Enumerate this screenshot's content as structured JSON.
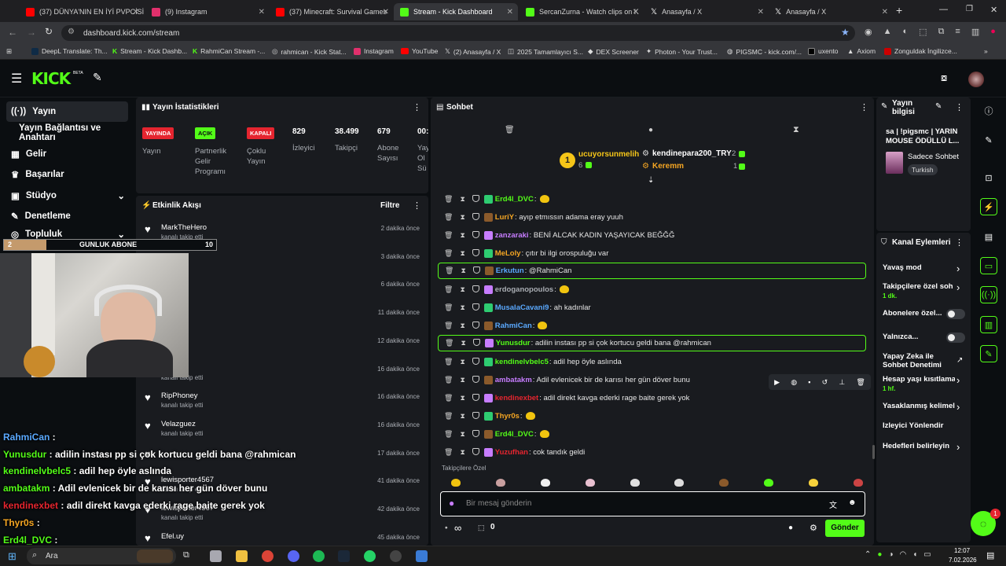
{
  "browser": {
    "tabs": [
      {
        "label": "(37) DÜNYA'NIN EN İYİ PVPCİSİ",
        "color": "#ff0000"
      },
      {
        "label": "(9) Instagram",
        "color": "#e1306c"
      },
      {
        "label": "(37) Minecraft: Survival Games",
        "color": "#ff0000"
      },
      {
        "label": "Stream - Kick Dashboard",
        "color": "#53fc18"
      },
      {
        "label": "SercanZurna - Watch clips on K",
        "color": "#53fc18"
      },
      {
        "label": "Anasayfa / X",
        "color": "#ffffff"
      },
      {
        "label": "Anasayfa / X",
        "color": "#ffffff"
      }
    ],
    "new_tab": "+",
    "url": "dashboard.kick.com/stream",
    "bookmarks": [
      "DeepL Translate: Th...",
      "Stream - Kick Dashb...",
      "RahmiCan Stream -...",
      "rahmican - Kick Stat...",
      "Instagram",
      "YouTube",
      "(2) Anasayfa / X",
      "2025 Tamamlayıcı S...",
      "DEX Screener",
      "Photon - Your Trust...",
      "PIGSMC - kick.com/...",
      "uxento",
      "Axiom",
      "Zonguldak İngilizce..."
    ]
  },
  "kick": {
    "logo": "KICK",
    "beta": "BETA"
  },
  "sidebar": {
    "items": [
      {
        "label": "Yayın",
        "icon": "broadcast-icon"
      },
      {
        "label": "Yayın Bağlantısı ve Anahtarı",
        "icon": ""
      },
      {
        "label": "Gelir",
        "icon": "money-icon"
      },
      {
        "label": "Başarılar",
        "icon": "trophy-icon"
      },
      {
        "label": "Stüdyo",
        "icon": "studio-icon"
      },
      {
        "label": "Denetleme",
        "icon": "wrench-icon"
      },
      {
        "label": "Topluluk",
        "icon": "community-icon"
      }
    ]
  },
  "stats": {
    "title": "Yayın İstatistikleri",
    "badges": [
      {
        "label": "YAYINDA",
        "sub": "Yayın",
        "color": "#e5252f"
      },
      {
        "label": "AÇIK",
        "sub": "Partnerlik Gelir Programı",
        "color": "#53fc18"
      },
      {
        "label": "KAPALI",
        "sub": "Çoklu Yayın",
        "color": "#e5252f"
      }
    ],
    "numbers": [
      {
        "value": "829",
        "label": "İzleyici"
      },
      {
        "value": "38.499",
        "label": "Takipçi"
      },
      {
        "value": "679",
        "label": "Abone Sayısı"
      },
      {
        "value": "00:",
        "label": "Yayın Ol Sü"
      }
    ]
  },
  "activity": {
    "title": "Etkinlik Akışı",
    "filter": "Filtre",
    "events": [
      {
        "name": "MarkTheHero",
        "sub": "kanalı takip etti",
        "time": "2 dakika önce"
      },
      {
        "name": "",
        "sub": "",
        "time": "3 dakika önce"
      },
      {
        "name": "",
        "sub": "",
        "time": "6 dakika önce"
      },
      {
        "name": "",
        "sub": "",
        "time": "11 dakika önce"
      },
      {
        "name": "",
        "sub": "",
        "time": "12 dakika önce"
      },
      {
        "name": "",
        "sub": "kanalı takip etti",
        "time": "16 dakika önce"
      },
      {
        "name": "RipPhoney",
        "sub": "kanalı takip etti",
        "time": "16 dakika önce"
      },
      {
        "name": "Velazguez",
        "sub": "kanalı takip etti",
        "time": "16 dakika önce"
      },
      {
        "name": "",
        "sub": "",
        "time": "17 dakika önce"
      },
      {
        "name": "lewisporter4567",
        "sub": "kanalı takip etti",
        "time": "41 dakika önce"
      },
      {
        "name": "lewisporter4567",
        "sub": "kanalı takip etti",
        "time": "42 dakika önce"
      },
      {
        "name": "Efel.uy",
        "sub": "",
        "time": "45 dakika önce"
      }
    ]
  },
  "overlay": {
    "sub_goal_count": "2",
    "sub_goal_label": "GUNLUK ABONE",
    "sub_goal_target": "10",
    "chat": [
      {
        "user": "RahmiCan",
        "msg": " :",
        "color": "#5aa9ff"
      },
      {
        "user": "Yunusdur",
        "msg": " : adilin instası pp si çok kortucu geldi bana @rahmican",
        "color": "#53fc18"
      },
      {
        "user": "kendinelvbelc5",
        "msg": " : adil hep öyle aslında",
        "color": "#53fc18"
      },
      {
        "user": "ambatakm",
        "msg": " : Adil evlenicek bir de karısı her gün döver bunu",
        "color": "#53fc18"
      },
      {
        "user": "kendinexbet",
        "msg": " : adil direkt kavga ederki rage baite gerek yok",
        "color": "#e5252f"
      },
      {
        "user": "Thyr0s",
        "msg": " :",
        "color": "#f5a623"
      },
      {
        "user": "Erd4l_DVC",
        "msg": " :",
        "color": "#53fc18"
      }
    ]
  },
  "chat": {
    "title": "Sohbet",
    "top_gifters": [
      {
        "rank": "1",
        "name": "ucuyorsunmelih",
        "count": "6"
      },
      {
        "name": "kendinepara200_TRY",
        "count": "2"
      },
      {
        "name": "Keremm",
        "count": "1"
      }
    ],
    "messages": [
      {
        "user": "Erd4l_DVC",
        "text": ":",
        "color": "#53fc18",
        "hl": false,
        "emote": true
      },
      {
        "user": "LuriY",
        "text": ": ayıp etmıssın adama eray yuuh",
        "color": "#f5a623",
        "hl": false,
        "emote": false
      },
      {
        "user": "zanzaraki",
        "text": ": BENİ ALCAK KADIN YAŞAYICAK BEĞĞĞ",
        "color": "#c77dff",
        "hl": false,
        "emote": false
      },
      {
        "user": "MeLoly",
        "text": ": çıtır bi ilgi orospuluğu var",
        "color": "#f5a623",
        "hl": false,
        "emote": false
      },
      {
        "user": "Erkutun",
        "text": ": @RahmiCan",
        "color": "#5aa9ff",
        "hl": true,
        "emote": false
      },
      {
        "user": "erdoganopoulos",
        "text": ":",
        "color": "#a9adb3",
        "hl": false,
        "emote": true
      },
      {
        "user": "MusalaCavani9",
        "text": ": ah kadınlar",
        "color": "#5aa9ff",
        "hl": false,
        "emote": false
      },
      {
        "user": "RahmiCan",
        "text": ":",
        "color": "#5aa9ff",
        "hl": false,
        "emote": true
      },
      {
        "user": "Yunusdur",
        "text": ": adilin instası pp si çok kortucu geldi bana @rahmican",
        "color": "#53fc18",
        "hl": true,
        "emote": false
      },
      {
        "user": "kendinelvbelc5",
        "text": ": adil hep öyle aslında",
        "color": "#53fc18",
        "hl": false,
        "emote": false
      },
      {
        "user": "ambatakm",
        "text": ": Adil evlenicek bir de karısı her gün döver bunu",
        "color": "#c77dff",
        "hl": false,
        "emote": false
      },
      {
        "user": "kendinexbet",
        "text": ": adil direkt kavga ederki rage baite gerek yok",
        "color": "#e5252f",
        "hl": false,
        "emote": false
      },
      {
        "user": "Thyr0s",
        "text": ":",
        "color": "#f5a623",
        "hl": false,
        "emote": true
      },
      {
        "user": "Erd4l_DVC",
        "text": ":",
        "color": "#53fc18",
        "hl": false,
        "emote": true
      },
      {
        "user": "Yuzufhan",
        "text": ": cok tandık geldi",
        "color": "#e5252f",
        "hl": false,
        "emote": false
      }
    ],
    "followers_only": "Takipçilere Özel",
    "input_placeholder": "Bir mesaj gönderin",
    "infinity": "∞",
    "points": "0",
    "send": "Gönder"
  },
  "stream_info": {
    "title": "Yayın bilgisi",
    "stream_title": "sa | !pigsmc | YARIN MOUSE ÖDÜLLÜ L...",
    "category": "Sadece Sohbet",
    "language": "Turkish"
  },
  "channel_actions": {
    "title": "Kanal Eylemleri",
    "items": [
      {
        "label": "Yavaş mod",
        "sub": "",
        "control": "chevron"
      },
      {
        "label": "Takipçilere özel soh",
        "sub": "1 dk.",
        "control": "chevron"
      },
      {
        "label": "Abonelere özel...",
        "sub": "",
        "control": "toggle"
      },
      {
        "label": "Yalnızca...",
        "sub": "",
        "control": "toggle"
      },
      {
        "label": "Yapay Zeka ile Sohbet Denetimi",
        "sub": "",
        "control": "external"
      },
      {
        "label": "Hesap yaşı kısıtlama",
        "sub": "1 hf.",
        "control": "chevron"
      },
      {
        "label": "Yasaklanmış kelimel",
        "sub": "",
        "control": "chevron"
      },
      {
        "label": "İzleyici Yönlendir",
        "sub": "",
        "control": "none"
      },
      {
        "label": "Hedefleri belirleyin",
        "sub": "",
        "control": "chevron"
      }
    ]
  },
  "taskbar": {
    "search": "Ara",
    "time": "12:07",
    "date": "7.02.2026"
  },
  "notification_count": "1"
}
